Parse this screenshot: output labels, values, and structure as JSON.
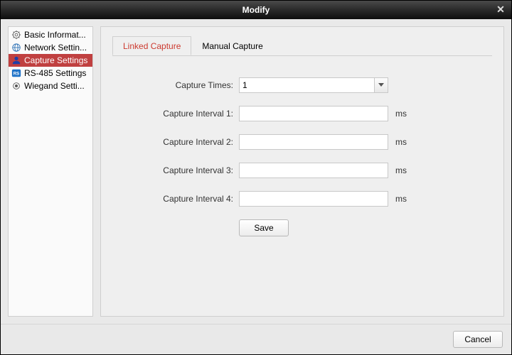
{
  "titlebar": {
    "title": "Modify"
  },
  "sidebar": {
    "items": [
      {
        "label": "Basic Informat..."
      },
      {
        "label": "Network Settin..."
      },
      {
        "label": "Capture Settings"
      },
      {
        "label": "RS-485 Settings"
      },
      {
        "label": "Wiegand Setti..."
      }
    ]
  },
  "tabs": [
    {
      "label": "Linked Capture"
    },
    {
      "label": "Manual Capture"
    }
  ],
  "form": {
    "capture_times_label": "Capture Times:",
    "capture_times_value": "1",
    "interval1_label": "Capture Interval 1:",
    "interval1_value": "",
    "interval2_label": "Capture Interval 2:",
    "interval2_value": "",
    "interval3_label": "Capture Interval 3:",
    "interval3_value": "",
    "interval4_label": "Capture Interval 4:",
    "interval4_value": "",
    "unit": "ms",
    "save_label": "Save"
  },
  "footer": {
    "cancel_label": "Cancel"
  }
}
